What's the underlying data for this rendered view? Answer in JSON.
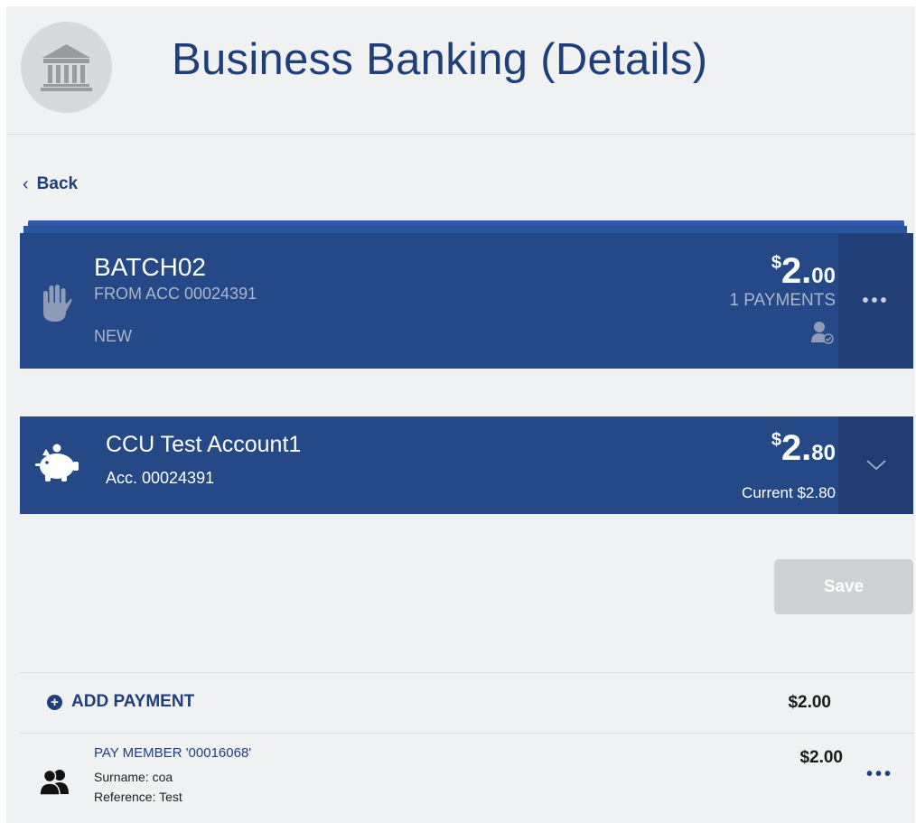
{
  "header": {
    "title": "Business Banking (Details)",
    "icon": "bank-icon"
  },
  "nav": {
    "back_label": "Back"
  },
  "batch": {
    "name": "BATCH02",
    "from": "FROM ACC 00024391",
    "status": "NEW",
    "amount_currency": "$",
    "amount_whole": "2.",
    "amount_decimal": "00",
    "payments_label": "1 PAYMENTS",
    "status_icon": "hand-stop-icon",
    "menu_icon": "more-horizontal-icon"
  },
  "account": {
    "name": "CCU Test Account1",
    "number": "Acc. 00024391",
    "amount_currency": "$",
    "amount_whole": "2.",
    "amount_decimal": "80",
    "current_label": "Current $2.80",
    "icon": "piggy-bank-icon"
  },
  "actions": {
    "save_label": "Save"
  },
  "payments": {
    "add_label": "ADD PAYMENT",
    "total": "$2.00",
    "items": [
      {
        "title": "PAY MEMBER '00016068'",
        "surname": "Surname: coa",
        "reference": "Reference: Test",
        "amount": "$2.00"
      }
    ]
  },
  "colors": {
    "brand_navy": "#254986",
    "title_blue": "#1f3f7a",
    "background": "#eff1f2",
    "disabled_button": "#cfd1d4"
  }
}
